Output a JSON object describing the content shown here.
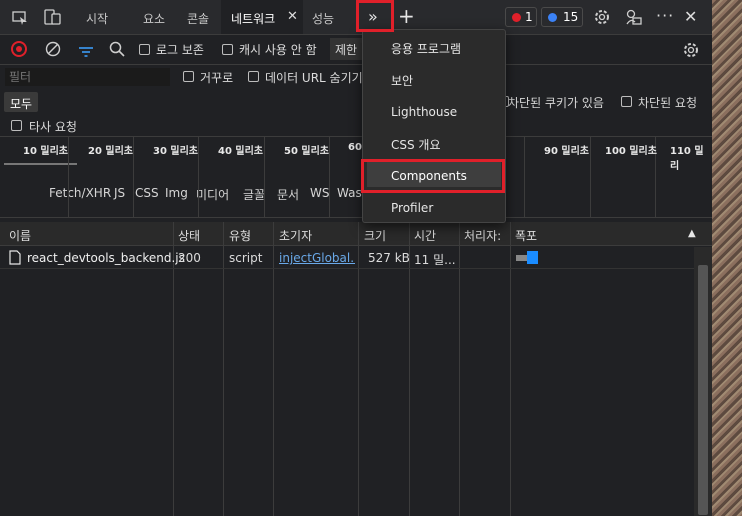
{
  "tabs": [
    "시작",
    "요소",
    "콘솔",
    "네트워크",
    "성능"
  ],
  "active_tab": "네트워크",
  "more_tabs_label": "»",
  "add_tab_label": "+",
  "errors_count": "1",
  "messages_count": "15",
  "toolbar": {
    "preserve_log": "로그 보존",
    "disable_cache": "캐시 사용 안 함",
    "throttling": "제한"
  },
  "filter": {
    "placeholder": "필터",
    "invert": "거꾸로",
    "hide_data_urls": "데이터 URL 숨기기",
    "types": [
      "모두",
      "Fetch/XHR",
      "JS",
      "CSS",
      "Img",
      "미디어",
      "글꼴",
      "문서",
      "WS",
      "Was"
    ],
    "blocked_cookies": "차단된 쿠키가 있음",
    "blocked_requests": "차단된 요청",
    "third_party": "타사 요청"
  },
  "timeline_ticks": [
    "10 밀리초",
    "20 밀리초",
    "30 밀리초",
    "40 밀리초",
    "50 밀리초",
    "60",
    "90 밀리초",
    "100 밀리초",
    "110 밀리"
  ],
  "columns": [
    "이름",
    "상태",
    "유형",
    "초기자",
    "크기",
    "시간",
    "처리자:",
    "폭포"
  ],
  "requests": [
    {
      "name": "react_devtools_backend.js",
      "status": "200",
      "type": "script",
      "initiator": "injectGlobal...",
      "size": "527 kB",
      "time": "11 밀...",
      "handler": ""
    }
  ],
  "more_menu": [
    "응용 프로그램",
    "보안",
    "Lighthouse",
    "CSS 개요",
    "Components",
    "Profiler"
  ],
  "highlighted_menu_item": "Components",
  "colors": {
    "background": "#202124",
    "highlight": "#e0202a",
    "link": "#6aa9e9",
    "error": "#e0202a",
    "info": "#3b82f6"
  }
}
